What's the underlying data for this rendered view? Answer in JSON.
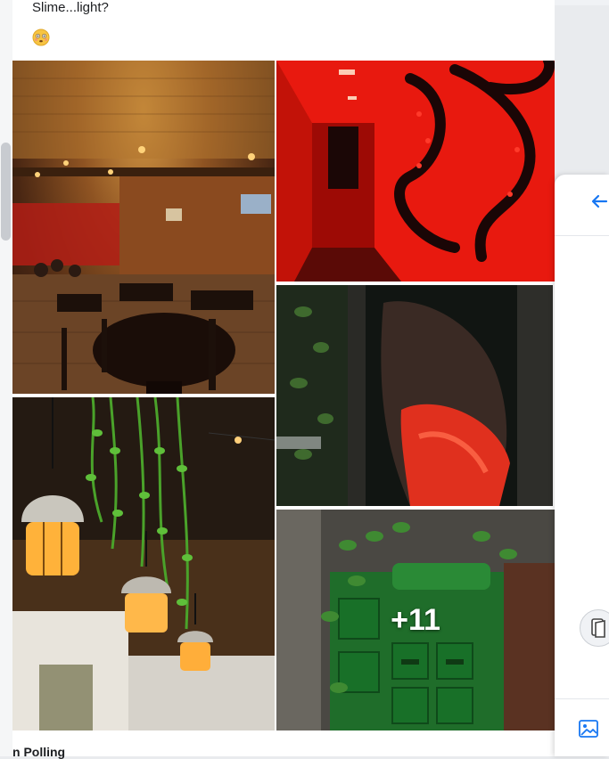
{
  "post": {
    "text": "Slime...light?",
    "emoji": "flushed-face-emoji"
  },
  "gallery": {
    "images": [
      {
        "name": "restaurant-interior-photo"
      },
      {
        "name": "red-octopus-hallway-photo"
      },
      {
        "name": "red-cloak-figure-photo"
      },
      {
        "name": "hanging-lanterns-photo"
      },
      {
        "name": "green-lockers-ivy-photo"
      }
    ],
    "more_count_label": "+11"
  },
  "next_post": {
    "author_partial": "n Polling"
  },
  "side_panel": {
    "back_icon": "arrow-left-icon",
    "attach_icon": "document-icon",
    "photo_icon": "photo-icon",
    "accent_color": "#1877f2"
  }
}
